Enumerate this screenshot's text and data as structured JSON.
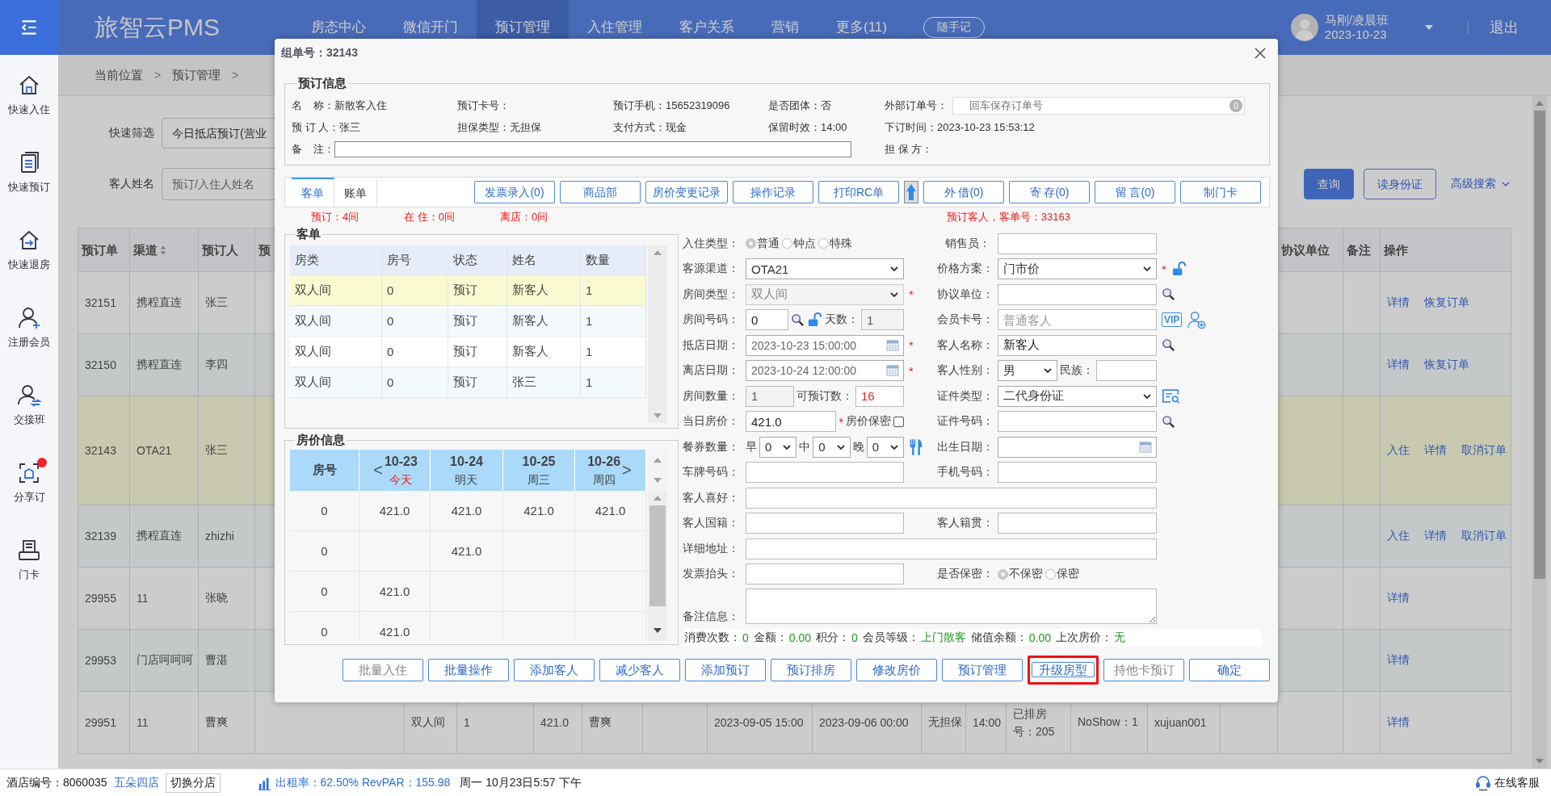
{
  "topbar": {
    "brand": "旅智云PMS",
    "nav": [
      {
        "label": "房态中心",
        "selected": false
      },
      {
        "label": "微信开门",
        "selected": false
      },
      {
        "label": "预订管理",
        "selected": true
      },
      {
        "label": "入住管理",
        "selected": false
      },
      {
        "label": "客户关系",
        "selected": false
      },
      {
        "label": "营销",
        "selected": false
      },
      {
        "label": "更多(11)",
        "selected": false
      }
    ],
    "quick_note": "随手记",
    "user": {
      "name": "马刚/凌晨班",
      "date": "2023-10-23"
    },
    "logout": "退出"
  },
  "sidebar": {
    "items": [
      {
        "label": "快速入住",
        "badge": false
      },
      {
        "label": "快速预订",
        "badge": false
      },
      {
        "label": "快速退房",
        "badge": false
      },
      {
        "label": "注册会员",
        "badge": false
      },
      {
        "label": "交接班",
        "badge": false
      },
      {
        "label": "分享订",
        "badge": true
      },
      {
        "label": "门卡",
        "badge": false
      }
    ]
  },
  "breadcrumb": [
    {
      "kind": "link",
      "text": "当前位置"
    },
    {
      "kind": "sep",
      "text": ">"
    },
    {
      "kind": "link",
      "text": "预订管理"
    },
    {
      "kind": "sep",
      "text": ">"
    }
  ],
  "filters": {
    "quick_filter": {
      "label": "快速筛选",
      "value": "今日抵店预订(营业"
    },
    "guest_name": {
      "label": "客人姓名",
      "placeholder": "预订/入住人姓名"
    },
    "buttons": [
      {
        "label": "查询",
        "primary": true
      },
      {
        "label": "读身份证",
        "primary": false
      }
    ],
    "advanced_search": "高级搜索"
  },
  "reservations": {
    "columns_left": [
      {
        "label": "预订单",
        "sortable": false
      },
      {
        "label": "渠道",
        "sortable": true
      },
      {
        "label": "预订人",
        "sortable": false
      },
      {
        "label": "预",
        "sortable": false
      }
    ],
    "columns_right": [
      {
        "label": "协议单位"
      },
      {
        "label": "备注"
      },
      {
        "label": "操作"
      }
    ],
    "rows": [
      {
        "id": "32151",
        "channel": "携程直连",
        "booker": "张三",
        "selected": false,
        "actions": [
          "详情",
          "恢复订单"
        ]
      },
      {
        "id": "32150",
        "channel": "携程直连",
        "booker": "李四",
        "selected": false,
        "actions": [
          "详情",
          "恢复订单"
        ]
      },
      {
        "id": "32143",
        "channel": "OTA21",
        "booker": "张三",
        "selected": true,
        "actions": [
          "入住",
          "详情",
          "取消订单"
        ]
      },
      {
        "id": "32139",
        "channel": "携程直连",
        "booker": "zhizhi",
        "selected": false,
        "actions": [
          "入住",
          "详情",
          "取消订单"
        ]
      },
      {
        "id": "29955",
        "channel": "11",
        "booker": "张晓",
        "selected": false,
        "actions": [
          "详情"
        ]
      },
      {
        "id": "29953",
        "channel": "门店呵呵呵",
        "booker": "曹湛",
        "selected": false,
        "actions": [
          "详情"
        ]
      },
      {
        "id": "29951",
        "channel": "11",
        "booker": "曹爽",
        "selected": false,
        "cells": [
          "双人间",
          "1",
          "421.0",
          "曹爽",
          null,
          "2023-09-05 15:00",
          "2023-09-06 00:00",
          "无担保",
          "14:00",
          "已排房号：205",
          "NoShow：1",
          "xujuan001"
        ],
        "actions": [
          "详情"
        ]
      }
    ]
  },
  "dialog": {
    "title": "组单号：32143",
    "booking_info": {
      "title": "预订信息",
      "rows": [
        [
          {
            "kind": "text",
            "label": "名    称：",
            "value": "新散客入住"
          },
          {
            "kind": "text",
            "label": "预订卡号："
          },
          {
            "kind": "text",
            "label": "预订手机：",
            "value": "15652319096"
          },
          {
            "kind": "text",
            "label": "是否团体：",
            "value": "否"
          },
          {
            "kind": "field",
            "label": "外部订单号：",
            "placeholder": "回车保存订单号",
            "count": "0"
          }
        ],
        [
          {
            "kind": "text",
            "label": "预 订 人：",
            "value": "张三"
          },
          {
            "kind": "text",
            "label": "担保类型：",
            "value": "无担保"
          },
          {
            "kind": "text",
            "label": "支付方式：",
            "value": "现金"
          },
          {
            "kind": "text",
            "label": "保留时效：",
            "value": "14:00"
          },
          {
            "kind": "text",
            "label": "下订时间：",
            "value": "2023-10-23 15:53:12"
          }
        ],
        [
          {
            "kind": "note",
            "label": "备    注："
          },
          "",
          "",
          "",
          {
            "kind": "text",
            "label": "担 保 方："
          }
        ]
      ]
    },
    "tabs": [
      {
        "label": "客单",
        "selected": true
      },
      {
        "label": "账单",
        "selected": false
      }
    ],
    "toolbar": [
      {
        "kind": "button",
        "label": "发票录入(0)"
      },
      {
        "kind": "button",
        "label": "商品部"
      },
      {
        "kind": "button",
        "label": "房价变更记录"
      },
      {
        "kind": "button",
        "label": "操作记录"
      },
      {
        "kind": "button",
        "label": "打印RC单"
      },
      {
        "kind": "arrow"
      },
      {
        "kind": "button",
        "label": "外 借(0)"
      },
      {
        "kind": "button",
        "label": "寄 存(0)"
      },
      {
        "kind": "button",
        "label": "留 言(0)"
      },
      {
        "kind": "button",
        "label": "制门卡"
      }
    ],
    "summary_left": [
      "预订：4间",
      "在 住：0间",
      "离店：0间"
    ],
    "summary_right": "预订客人，客单号：33163",
    "guest_list": {
      "title": "客单",
      "columns": [
        "房类",
        "房号",
        "状态",
        "姓名",
        "数量"
      ],
      "rows": [
        {
          "cells": [
            "双人间",
            "0",
            "预订",
            "新客人",
            "1"
          ],
          "selected": true
        },
        {
          "cells": [
            "双人间",
            "0",
            "预订",
            "新客人",
            "1"
          ],
          "selected": false
        },
        {
          "cells": [
            "双人间",
            "0",
            "预订",
            "新客人",
            "1"
          ],
          "selected": false
        },
        {
          "cells": [
            "双人间",
            "0",
            "预订",
            "张三",
            "1"
          ],
          "selected": false
        }
      ]
    },
    "rates": {
      "title": "房价信息",
      "room_header": "房号",
      "prev": "<",
      "next": ">",
      "days": [
        {
          "date": "10-23",
          "day": "今天",
          "today": true
        },
        {
          "date": "10-24",
          "day": "明天",
          "today": false
        },
        {
          "date": "10-25",
          "day": "周三",
          "today": false
        },
        {
          "date": "10-26",
          "day": "周四",
          "today": false
        }
      ],
      "rows": [
        [
          "0",
          "421.0",
          "421.0",
          "421.0",
          "421.0"
        ],
        [
          "0",
          null,
          "421.0",
          null,
          null
        ],
        [
          "0",
          "421.0",
          null,
          null,
          null
        ],
        [
          "0",
          "421.0",
          null,
          null,
          null
        ]
      ]
    },
    "form": {
      "rows": [
        {
          "items": [
            {
              "label": "入住类型：",
              "parts": [
                {
                  "kind": "radio",
                  "label": "普通",
                  "selected": true
                },
                {
                  "kind": "radio",
                  "label": "钟点",
                  "selected": false
                },
                {
                  "kind": "radio",
                  "label": "特殊",
                  "selected": false
                }
              ]
            },
            {
              "label": "销售员：",
              "parts": [
                {
                  "kind": "input"
                }
              ]
            }
          ]
        },
        {
          "items": [
            {
              "label": "客源渠道：",
              "parts": [
                {
                  "kind": "select",
                  "value": "OTA21",
                  "disabled": false
                }
              ]
            },
            {
              "label": "价格方案：",
              "parts": [
                {
                  "kind": "select",
                  "value": "门市价",
                  "disabled": false
                }
              ],
              "after": [
                {
                  "kind": "mark",
                  "text": "*"
                },
                {
                  "kind": "lock"
                }
              ]
            }
          ]
        },
        {
          "items": [
            {
              "label": "房间类型：",
              "parts": [
                {
                  "kind": "select",
                  "value": "双人间",
                  "disabled": true
                }
              ],
              "after": [
                {
                  "kind": "mark",
                  "text": "*"
                }
              ]
            },
            {
              "label": "协议单位：",
              "parts": [
                {
                  "kind": "input"
                }
              ],
              "after": [
                {
                  "kind": "search"
                }
              ]
            }
          ]
        },
        {
          "items": [
            {
              "label": "房间号码：",
              "parts": [
                {
                  "kind": "input",
                  "value": "0"
                },
                {
                  "kind": "search"
                },
                {
                  "kind": "lock"
                },
                {
                  "kind": "text",
                  "text": "天数："
                },
                {
                  "kind": "input",
                  "value": "1",
                  "disabled": true
                }
              ]
            },
            {
              "label": "会员卡号：",
              "parts": [
                {
                  "kind": "input",
                  "placeholder": "普通客人"
                }
              ],
              "after": [
                {
                  "kind": "vip",
                  "text": "VIP"
                },
                {
                  "kind": "user_add"
                }
              ]
            }
          ]
        },
        {
          "items": [
            {
              "label": "抵店日期：",
              "parts": [
                {
                  "kind": "date",
                  "value": "2023-10-23 15:00:00"
                }
              ],
              "after": [
                {
                  "kind": "mark",
                  "text": "*"
                }
              ]
            },
            {
              "label": "客人名称：",
              "parts": [
                {
                  "kind": "input",
                  "value": "新客人"
                }
              ],
              "after": [
                {
                  "kind": "search"
                }
              ]
            }
          ]
        },
        {
          "items": [
            {
              "label": "离店日期：",
              "parts": [
                {
                  "kind": "date",
                  "value": "2023-10-24 12:00:00"
                }
              ],
              "after": [
                {
                  "kind": "mark",
                  "text": "*"
                }
              ]
            },
            {
              "label": "客人性别：",
              "parts": [
                {
                  "kind": "select",
                  "value": "男",
                  "disabled": false
                },
                {
                  "kind": "text",
                  "text": "民族："
                },
                {
                  "kind": "input"
                }
              ]
            }
          ]
        },
        {
          "items": [
            {
              "label": "房间数量：",
              "parts": [
                {
                  "kind": "input",
                  "value": "1",
                  "disabled": true
                },
                {
                  "kind": "text",
                  "text": "可预订数："
                },
                {
                  "kind": "input",
                  "value": "16",
                  "emphasis": true
                }
              ]
            },
            {
              "label": "证件类型：",
              "parts": [
                {
                  "kind": "select",
                  "value": "二代身份证",
                  "disabled": false
                }
              ],
              "after": [
                {
                  "kind": "id_scan"
                }
              ]
            }
          ]
        },
        {
          "items": [
            {
              "label": "当日房价：",
              "parts": [
                {
                  "kind": "input",
                  "value": "421.0"
                },
                {
                  "kind": "mark",
                  "text": "*"
                },
                {
                  "kind": "text",
                  "text": "房价保密"
                },
                {
                  "kind": "checkbox",
                  "checked": false
                }
              ]
            },
            {
              "label": "证件号码：",
              "parts": [
                {
                  "kind": "input"
                }
              ],
              "after": [
                {
                  "kind": "search"
                }
              ]
            }
          ]
        },
        {
          "items": [
            {
              "label": "餐券数量：",
              "parts": [
                {
                  "kind": "text",
                  "text": "早"
                },
                {
                  "kind": "select",
                  "value": "0",
                  "disabled": false
                },
                {
                  "kind": "text",
                  "text": "中"
                },
                {
                  "kind": "select",
                  "value": "0",
                  "disabled": false
                },
                {
                  "kind": "text",
                  "text": "晚"
                },
                {
                  "kind": "select",
                  "value": "0",
                  "disabled": false
                }
              ],
              "after": [
                {
                  "kind": "utensils"
                }
              ]
            },
            {
              "label": "出生日期：",
              "parts": [
                {
                  "kind": "date"
                }
              ]
            }
          ]
        },
        {
          "items": [
            {
              "label": "车牌号码：",
              "parts": [
                {
                  "kind": "input"
                }
              ]
            },
            {
              "label": "手机号码：",
              "parts": [
                {
                  "kind": "input"
                }
              ]
            }
          ]
        },
        {
          "items": [
            {
              "label": "客人喜好：",
              "parts": [
                {
                  "kind": "input"
                }
              ]
            }
          ]
        },
        {
          "items": [
            {
              "label": "客人国籍：",
              "parts": [
                {
                  "kind": "input"
                }
              ]
            },
            {
              "label": "客人籍贯：",
              "parts": [
                {
                  "kind": "input"
                }
              ]
            }
          ]
        },
        {
          "items": [
            {
              "label": "详细地址：",
              "parts": [
                {
                  "kind": "input"
                }
              ]
            }
          ]
        },
        {
          "items": [
            {
              "label": "发票抬头：",
              "parts": [
                {
                  "kind": "input"
                }
              ]
            },
            {
              "label": "是否保密：",
              "parts": [
                {
                  "kind": "radio",
                  "label": "不保密",
                  "selected": true
                },
                {
                  "kind": "radio",
                  "label": "保密",
                  "selected": false
                }
              ]
            }
          ]
        },
        {
          "items": [
            {
              "label": "备注信息：",
              "parts": [
                {
                  "kind": "textarea"
                }
              ]
            }
          ]
        }
      ]
    },
    "stats": [
      {
        "label": "消费次数：",
        "value": "0"
      },
      {
        "label": "金额：",
        "value": "0.00"
      },
      {
        "label": "积分：",
        "value": "0"
      },
      {
        "label": "会员等级：",
        "value": "上门散客"
      },
      {
        "label": "储值余额：",
        "value": "0.00"
      },
      {
        "label": "上次房价：",
        "value": "无"
      }
    ],
    "actions": [
      {
        "label": "批量入住",
        "disabled": true,
        "highlighted": false
      },
      {
        "label": "批量操作",
        "disabled": false,
        "highlighted": false
      },
      {
        "label": "添加客人",
        "disabled": false,
        "highlighted": false
      },
      {
        "label": "减少客人",
        "disabled": false,
        "highlighted": false
      },
      {
        "label": "添加预订",
        "disabled": false,
        "highlighted": false
      },
      {
        "label": "预订排房",
        "disabled": false,
        "highlighted": false
      },
      {
        "label": "修改房价",
        "disabled": false,
        "highlighted": false
      },
      {
        "label": "预订管理",
        "disabled": false,
        "highlighted": false
      },
      {
        "label": "升级房型",
        "disabled": false,
        "highlighted": true
      },
      {
        "label": "持他卡预订",
        "disabled": true,
        "highlighted": false
      },
      {
        "label": "确定",
        "disabled": false,
        "highlighted": false
      }
    ]
  },
  "status_bar": {
    "hotel": "酒店编号：8060035",
    "branch": "五朵四店",
    "switch": "切换分店",
    "occupancy": "出租率：62.50% RevPAR：155.98",
    "datetime": "周一 10月23日5:57 下午",
    "support": "在线客服"
  }
}
